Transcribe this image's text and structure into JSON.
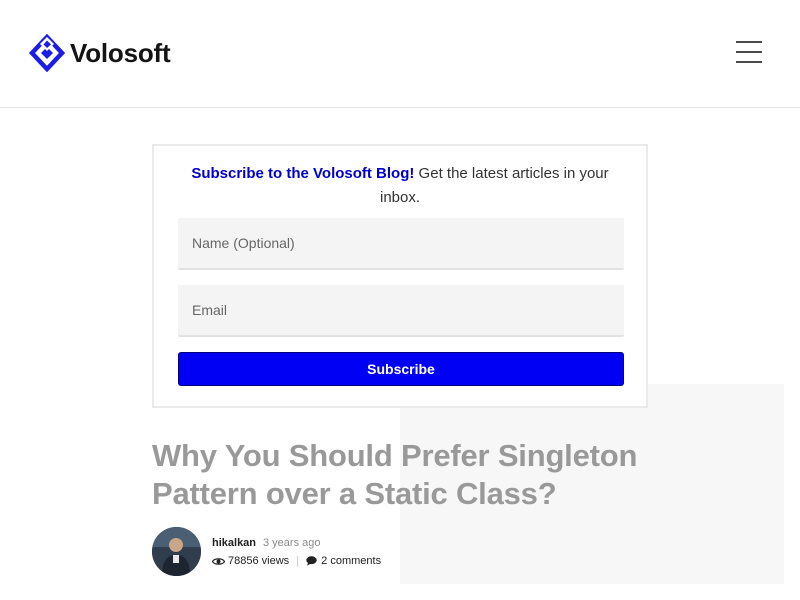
{
  "header": {
    "brand_name": "Volosoft",
    "logo_icon": "volosoft-logo-icon",
    "menu_icon": "hamburger-menu-icon"
  },
  "subscribe": {
    "title_link": "Subscribe to the Volosoft Blog!",
    "description": " Get the latest articles in your inbox.",
    "name_placeholder": "Name (Optional)",
    "email_placeholder": "Email",
    "button_label": "Subscribe"
  },
  "post": {
    "title": "Why You Should Prefer Singleton Pattern over a Static Class?",
    "author": "hikalkan",
    "time_ago": "3 years ago",
    "views": "78856 views",
    "comments": "2 comments",
    "views_icon": "eye-icon",
    "comments_icon": "comment-bubble-icon"
  },
  "colors": {
    "accent": "#0000f5",
    "brand_link": "#0000cc",
    "logo": "#1c1ce6",
    "title": "#999999"
  }
}
